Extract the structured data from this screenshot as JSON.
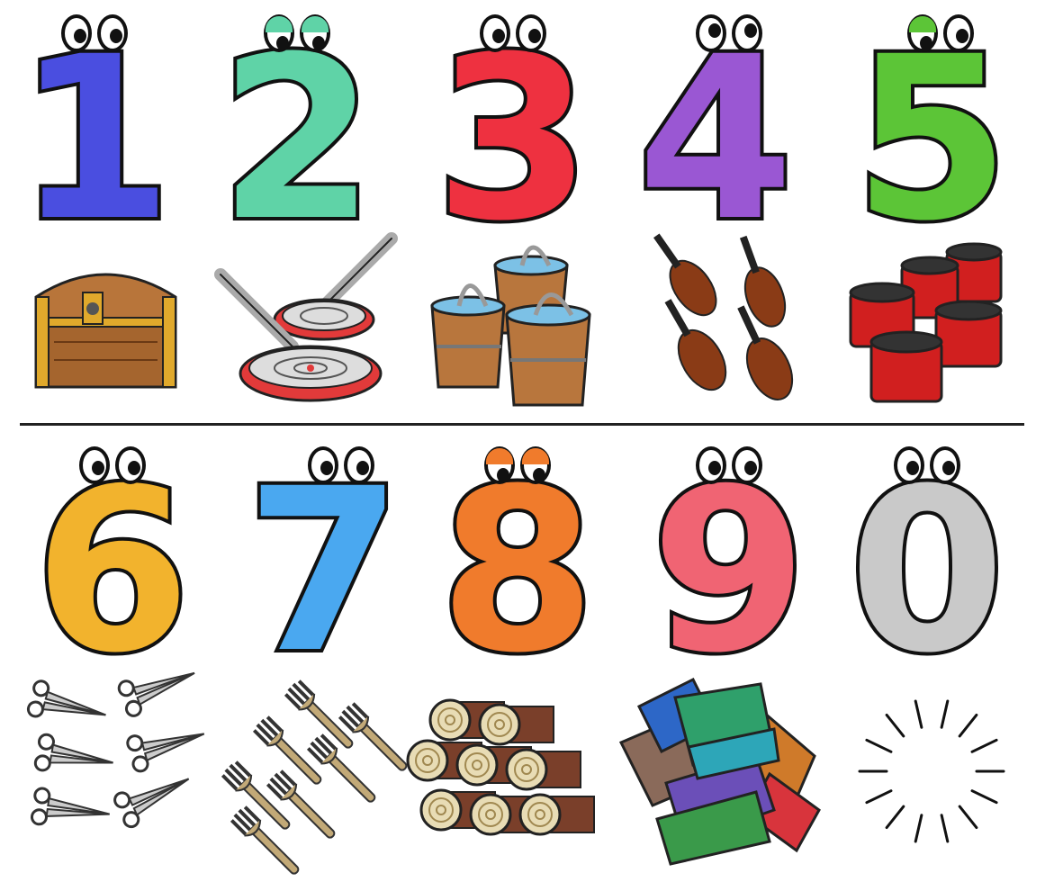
{
  "digits": [
    {
      "label": "1",
      "color": "#4a4ee0"
    },
    {
      "label": "2",
      "color": "#5fd3a7"
    },
    {
      "label": "3",
      "color": "#ee3140"
    },
    {
      "label": "4",
      "color": "#9a57d3"
    },
    {
      "label": "5",
      "color": "#5cc537"
    },
    {
      "label": "6",
      "color": "#f2b32d"
    },
    {
      "label": "7",
      "color": "#4aa8f0"
    },
    {
      "label": "8",
      "color": "#f07b2c"
    },
    {
      "label": "9",
      "color": "#f06473"
    },
    {
      "label": "0",
      "color": "#c9c9c9"
    }
  ],
  "objects": [
    {
      "name": "treasure-chest-icon",
      "count": 1
    },
    {
      "name": "frying-pans-icon",
      "count": 2
    },
    {
      "name": "wooden-buckets-icon",
      "count": 3
    },
    {
      "name": "violins-icon",
      "count": 4
    },
    {
      "name": "red-pots-icon",
      "count": 5
    },
    {
      "name": "scissors-icon",
      "count": 6
    },
    {
      "name": "forks-icon",
      "count": 7
    },
    {
      "name": "logs-icon",
      "count": 8
    },
    {
      "name": "books-icon",
      "count": 9
    },
    {
      "name": "empty-burst-icon",
      "count": 0
    }
  ]
}
